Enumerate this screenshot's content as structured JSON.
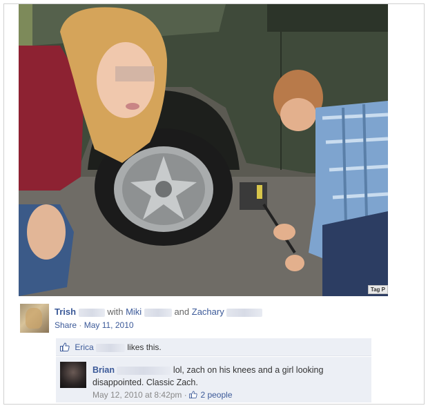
{
  "photo": {
    "tag_label": "Tag P"
  },
  "post": {
    "author": "Trish",
    "with_label": "with",
    "with_person_1": "Miki",
    "and_label": "and",
    "with_person_2": "Zachary",
    "share_label": "Share",
    "separator": "·",
    "date": "May 11, 2010"
  },
  "likes": {
    "name": "Erica",
    "text": "likes this."
  },
  "comment": {
    "author": "Brian",
    "text_line1": "lol, zach on his knees and a girl looking",
    "text_line2": "disappointed. Classic Zach.",
    "timestamp": "May 12, 2010 at 8:42pm",
    "separator": "·",
    "likes_count": "2 people"
  },
  "colors": {
    "link": "#3b5998",
    "meta": "#888888",
    "comment_bg": "#eceff5"
  },
  "icons": [
    "thumbs-up-icon",
    "thumbs-up-small-icon"
  ]
}
